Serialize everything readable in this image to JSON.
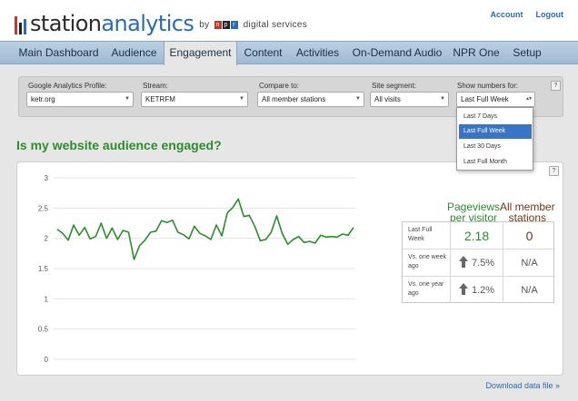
{
  "brand": {
    "name_prefix": "station",
    "name_accent": "analytics",
    "by": "by",
    "npr_letters": [
      "n",
      "p",
      "r"
    ],
    "suffix": "digital services",
    "colors": {
      "bar_red": "#c0392b",
      "bar_black": "#222222",
      "bar_blue": "#2a6bb2"
    }
  },
  "top_links": {
    "account": "Account",
    "logout": "Logout"
  },
  "nav": {
    "items": [
      "Main Dashboard",
      "Audience",
      "Engagement",
      "Content",
      "Activities",
      "On-Demand Audio",
      "NPR One",
      "Setup"
    ],
    "active": "Engagement"
  },
  "filters": {
    "profile": {
      "label": "Google Analytics Profile:",
      "value": "ketr.org"
    },
    "stream": {
      "label": "Stream:",
      "value": "KETRFM"
    },
    "compare": {
      "label": "Compare to:",
      "value": "All member stations"
    },
    "segment": {
      "label": "Site segment:",
      "value": "All visits"
    },
    "numbers": {
      "label": "Show numbers for:",
      "value": "Last Full Week"
    },
    "help": "?"
  },
  "dropdown": {
    "options": [
      "Last 7 Days",
      "Last Full Week",
      "Last 30 Days",
      "Last Full Month"
    ],
    "selected": "Last Full Week"
  },
  "section_title": "Is my website audience engaged?",
  "chart_help": "?",
  "chart_data": {
    "type": "line",
    "title": "",
    "xlabel": "",
    "ylabel": "",
    "ylim": [
      0,
      3
    ],
    "yticks": [
      "0",
      "0.5",
      "1",
      "1.5",
      "2",
      "2.5",
      "3"
    ],
    "grid": true,
    "legend": "none",
    "color": "#2d8c2d",
    "x": [
      1,
      2,
      3,
      4,
      5,
      6,
      7,
      8,
      9,
      10,
      11,
      12,
      13,
      14,
      15,
      16,
      17,
      18,
      19,
      20,
      21,
      22,
      23,
      24,
      25,
      26,
      27,
      28,
      29,
      30,
      31,
      32,
      33,
      34,
      35,
      36,
      37,
      38,
      39,
      40,
      41,
      42,
      43,
      44,
      45,
      46,
      47,
      48,
      49,
      50
    ],
    "values": [
      2.15,
      2.08,
      1.97,
      2.22,
      2.05,
      2.18,
      1.99,
      2.03,
      2.25,
      2.0,
      2.17,
      1.98,
      2.13,
      2.1,
      1.65,
      1.88,
      1.97,
      2.1,
      2.12,
      2.29,
      2.26,
      2.3,
      2.1,
      2.06,
      1.99,
      2.2,
      2.08,
      2.04,
      1.98,
      2.22,
      2.04,
      2.42,
      2.51,
      2.65,
      2.36,
      2.38,
      2.2,
      1.96,
      1.98,
      2.1,
      2.37,
      2.08,
      1.9,
      1.98,
      2.03,
      1.93,
      1.95,
      1.92,
      2.05,
      2.02,
      2.03,
      2.02,
      2.07,
      2.05,
      2.18
    ]
  },
  "stats": {
    "headers": {
      "pageviews": "Pageviews per visitor",
      "pageviews_line1": "Pageviews",
      "pageviews_line2": "per visitor",
      "members_line1": "All member",
      "members_line2": "stations"
    },
    "rows": [
      {
        "label": "Last Full Week",
        "pageviews": "2.18",
        "members": "0"
      },
      {
        "label": "Vs. one week ago",
        "pageviews": "7.5%",
        "members": "N/A"
      },
      {
        "label": "Vs. one year ago",
        "pageviews": "1.2%",
        "members": "N/A"
      }
    ]
  },
  "download_link": "Download data file »"
}
